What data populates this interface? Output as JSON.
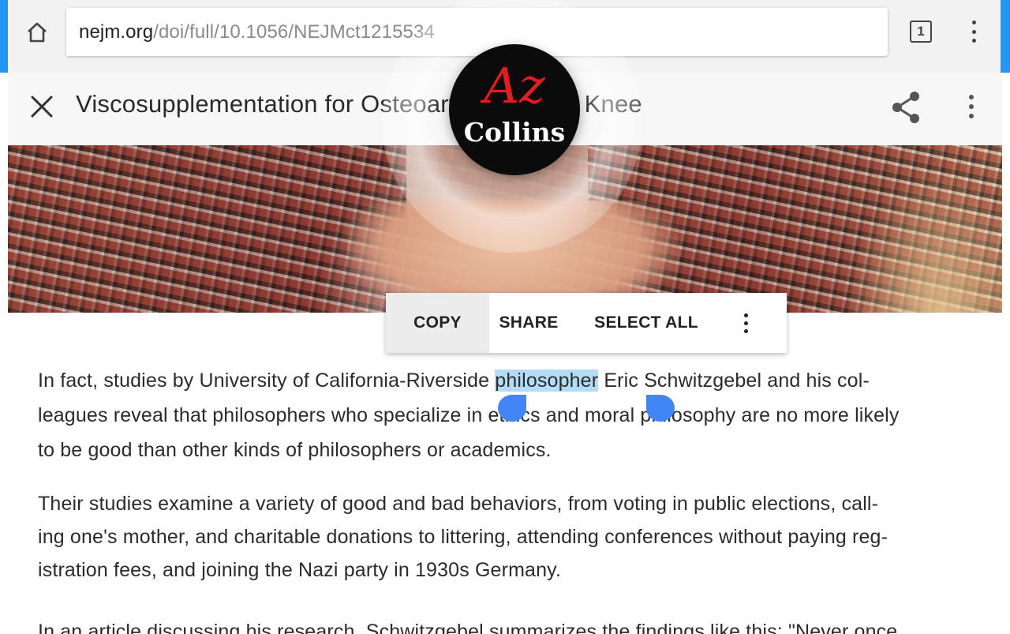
{
  "browser": {
    "url_host": "nejm.org",
    "url_path": "/doi/full/10.1056/NEJMct1215534",
    "tab_count": "1",
    "icons": {
      "home": "home-icon",
      "tabs": "tabs-icon",
      "menu": "more-vert-icon"
    }
  },
  "article_toolbar": {
    "title": "Viscosupplementation for Osteoarthritis of the Knee",
    "icons": {
      "close": "close-icon",
      "share": "share-icon",
      "menu": "more-vert-icon"
    }
  },
  "collins": {
    "az": "Az",
    "name": "Collins",
    "colors": {
      "badge": "#0b0b0b",
      "accent": "#e31b23"
    }
  },
  "selection_menu": {
    "copy": "COPY",
    "share": "SHARE",
    "select_all": "SELECT ALL",
    "more_icon": "more-vert-icon"
  },
  "article": {
    "p1": {
      "l1_before": "In fact, studies by University of California-Riverside ",
      "l1_selected": "philosopher",
      "l1_after": " Eric Schwitzgebel and his col-",
      "l2": "leagues reveal that philosophers who specialize in ethics and moral philosophy are no more likely",
      "l3": "to be good than other kinds of philosophers or academics."
    },
    "p2": {
      "l1": " Their studies examine a variety of good and bad behaviors, from voting in public elections, call-",
      "l2": "ing one's mother, and charitable donations to littering, attending conferences without paying reg-",
      "l3": "istration fees, and joining the Nazi party in 1930s Germany."
    },
    "p3": {
      "l1": "In an article discussing his research, Schwitzgebel summarizes the findings like this: \"Never once"
    }
  },
  "colors": {
    "chrome_accent": "#2196f3",
    "selection": "#b3dcf6",
    "handle": "#4285f4"
  }
}
